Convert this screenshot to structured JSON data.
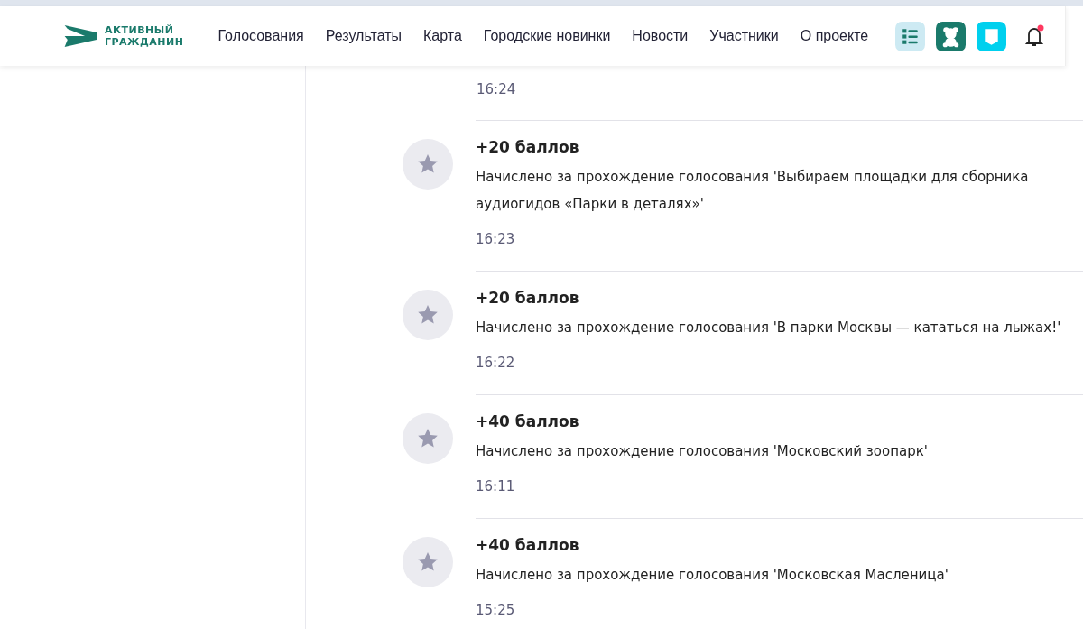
{
  "header": {
    "logo_text": [
      "АКТИВНЫЙ",
      "ГРАЖДАНИН"
    ],
    "nav": [
      "Голосования",
      "Результаты",
      "Карта",
      "Городские новинки",
      "Новости",
      "Участники",
      "О проекте"
    ],
    "notification_badge": true
  },
  "partial_entry": {
    "time": "16:24"
  },
  "entries": [
    {
      "points": "+20 баллов",
      "description": "Начислено за прохождение голосования 'Выбираем площадки для сборника аудиогидов «Парки в деталях»'",
      "time": "16:23"
    },
    {
      "points": "+20 баллов",
      "description": "Начислено за прохождение голосования 'В парки Москвы — кататься на лыжах!'",
      "time": "16:22"
    },
    {
      "points": "+40 баллов",
      "description": "Начислено за прохождение голосования 'Московский зоопарк'",
      "time": "16:11"
    },
    {
      "points": "+40 баллов",
      "description": "Начислено за прохождение голосования 'Московская Масленица'",
      "time": "15:25"
    }
  ]
}
